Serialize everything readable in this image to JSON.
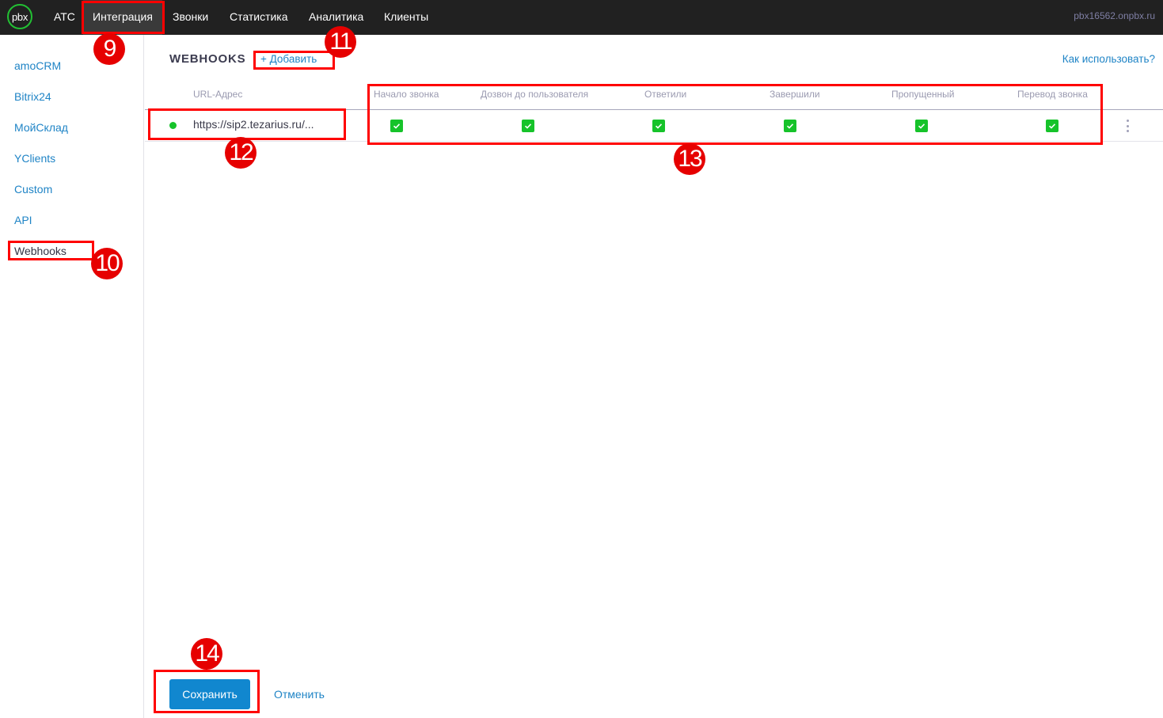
{
  "topbar": {
    "logo": "pbx",
    "nav": [
      {
        "label": "АТС",
        "active": false
      },
      {
        "label": "Интеграция",
        "active": true
      },
      {
        "label": "Звонки",
        "active": false
      },
      {
        "label": "Статистика",
        "active": false
      },
      {
        "label": "Аналитика",
        "active": false
      },
      {
        "label": "Клиенты",
        "active": false
      }
    ],
    "host": "pbx16562.onpbx.ru"
  },
  "sidebar": {
    "items": [
      {
        "label": "amoCRM"
      },
      {
        "label": "Bitrix24"
      },
      {
        "label": "МойСклад"
      },
      {
        "label": "YClients"
      },
      {
        "label": "Custom"
      },
      {
        "label": "API"
      },
      {
        "label": "Webhooks",
        "active": true
      }
    ]
  },
  "main": {
    "title": "WEBHOOKS",
    "add_label": "+ Добавить",
    "howto_label": "Как использовать?",
    "table": {
      "columns": [
        "URL-Адрес",
        "Начало звонка",
        "Дозвон до пользователя",
        "Ответили",
        "Завершили",
        "Пропущенный",
        "Перевод звонка"
      ],
      "rows": [
        {
          "status": "active",
          "url": "https://sip2.tezarius.ru/...",
          "events": [
            true,
            true,
            true,
            true,
            true,
            true
          ]
        }
      ]
    },
    "save_label": "Сохранить",
    "cancel_label": "Отменить"
  },
  "annotations": [
    "9",
    "10",
    "11",
    "12",
    "13",
    "14"
  ],
  "colors": {
    "accent": "#1187cf",
    "link": "#1f84c6",
    "success": "#16c32a",
    "topbar": "#212121",
    "annotation": "#ff0000"
  }
}
